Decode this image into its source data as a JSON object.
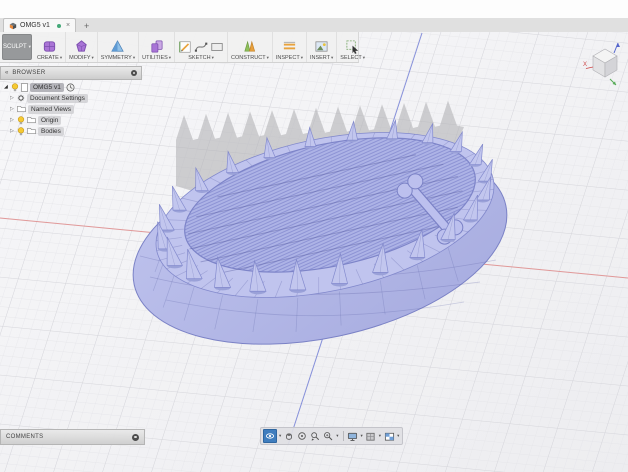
{
  "window": {
    "tab_title": "OMG5 v1",
    "close_glyph": "×",
    "new_tab_glyph": "+",
    "saved_dot_color": "#44a878"
  },
  "toolbar": {
    "mode_label": "SCULPT",
    "caret": "▾",
    "groups": [
      {
        "label": "CREATE"
      },
      {
        "label": "MODIFY"
      },
      {
        "label": "SYMMETRY"
      },
      {
        "label": "UTILITIES"
      },
      {
        "label": "SKETCH"
      },
      {
        "label": "CONSTRUCT"
      },
      {
        "label": "INSPECT"
      },
      {
        "label": "INSERT"
      },
      {
        "label": "SELECT"
      }
    ]
  },
  "browser": {
    "collapse_glyph": "«",
    "title": "BROWSER",
    "expand_glyph": "◢",
    "item_glyph": "▷",
    "root_label": "OMG5 v1",
    "items": [
      {
        "label": "Document Settings"
      },
      {
        "label": "Named Views"
      },
      {
        "label": "Origin"
      },
      {
        "label": "Bodies"
      }
    ]
  },
  "comments": {
    "label": "COMMENTS"
  },
  "viewcube": {
    "x_label": "X"
  },
  "viewport": {
    "bg": "#f5f5f7",
    "grid_minor": "#e3e3e7",
    "grid_major": "#d2d2d8",
    "axis_x": "#e09090",
    "axis_z": "#7b86d8",
    "shadow": "#b2b2b6",
    "model_fill": "#b6bae8",
    "model_fill_light": "#c0c4ee",
    "model_edge": "#7b82c6",
    "stripe_bg": "#adb3e6",
    "stripe_line": "#8990d2",
    "spike_fill": "#c2c6ee",
    "spike_edge": "#848bce",
    "nav_active": "#3f7dbe"
  }
}
